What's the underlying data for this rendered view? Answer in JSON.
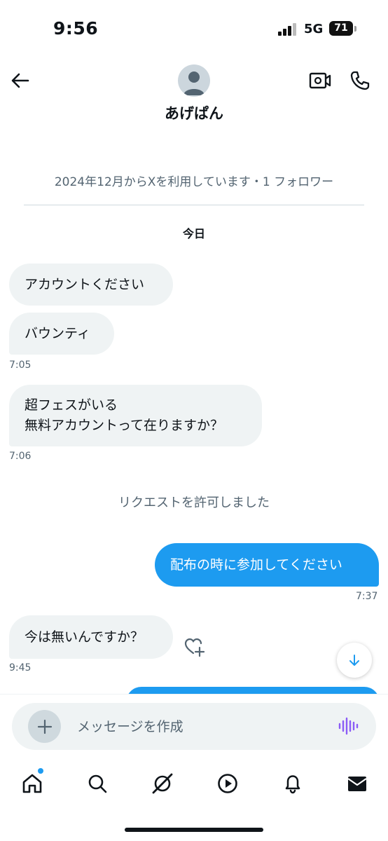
{
  "status_bar": {
    "time": "9:56",
    "network": "5G",
    "battery": "71"
  },
  "header": {
    "profile_name": "あげぱん",
    "icons": [
      "back-arrow-icon",
      "default-avatar",
      "video-camera-icon",
      "phone-icon"
    ]
  },
  "profile_meta": "2024年12月からXを利用しています・1 フォロワー",
  "date_separator": "今日",
  "messages": [
    {
      "text": "アカウントください"
    },
    {
      "text": "バウンティ",
      "time": "7:05"
    },
    {
      "line1": "超フェスがいる",
      "line2": "無料アカウントって在りますか？",
      "time": "7:06"
    }
  ],
  "system_message": "リクエストを許可しました",
  "sent_messages": [
    {
      "text": "配布の時に参加してください",
      "time": "7:37"
    }
  ],
  "reply_message": {
    "text": "今は無いんですか？",
    "time": "9:45"
  },
  "composer": {
    "placeholder": "メッセージを作成"
  },
  "bottom_nav": {
    "items": [
      "home-icon",
      "search-icon",
      "grok-icon",
      "video-icon",
      "notifications-icon",
      "messages-icon"
    ],
    "active": "home-icon"
  },
  "colors": {
    "accent": "#1d9bf0",
    "bubble_in": "#eff3f4",
    "text_secondary": "#536471",
    "voice_icon": "#8b5cf6"
  }
}
